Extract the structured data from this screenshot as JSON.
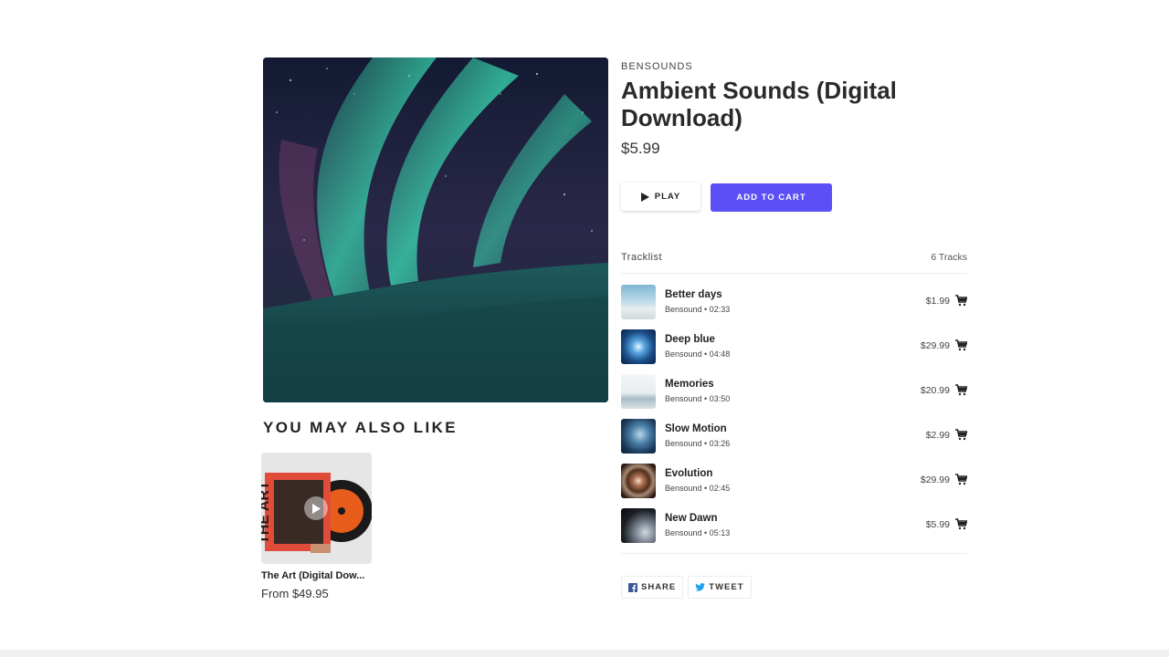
{
  "product": {
    "vendor": "BENSOUNDS",
    "title": "Ambient Sounds (Digital Download)",
    "price": "$5.99",
    "image_icon": "aurora-artwork"
  },
  "actions": {
    "play_label": "PLAY",
    "add_to_cart_label": "ADD TO CART",
    "accent_color": "#5b4ff5"
  },
  "tracklist": {
    "label": "Tracklist",
    "count_label": "6 Tracks",
    "tracks": [
      {
        "name": "Better days",
        "meta": "Bensound • 02:33",
        "price": "$1.99"
      },
      {
        "name": "Deep blue",
        "meta": "Bensound • 04:48",
        "price": "$29.99"
      },
      {
        "name": "Memories",
        "meta": "Bensound • 03:50",
        "price": "$20.99"
      },
      {
        "name": "Slow Motion",
        "meta": "Bensound • 03:26",
        "price": "$2.99"
      },
      {
        "name": "Evolution",
        "meta": "Bensound • 02:45",
        "price": "$29.99"
      },
      {
        "name": "New Dawn",
        "meta": "Bensound • 05:13",
        "price": "$5.99"
      }
    ]
  },
  "also_like": {
    "heading": "YOU MAY ALSO LIKE",
    "items": [
      {
        "name": "The Art (Digital Dow...",
        "price": "From $49.95"
      }
    ]
  },
  "share": {
    "facebook_label": "SHARE",
    "twitter_label": "TWEET"
  }
}
